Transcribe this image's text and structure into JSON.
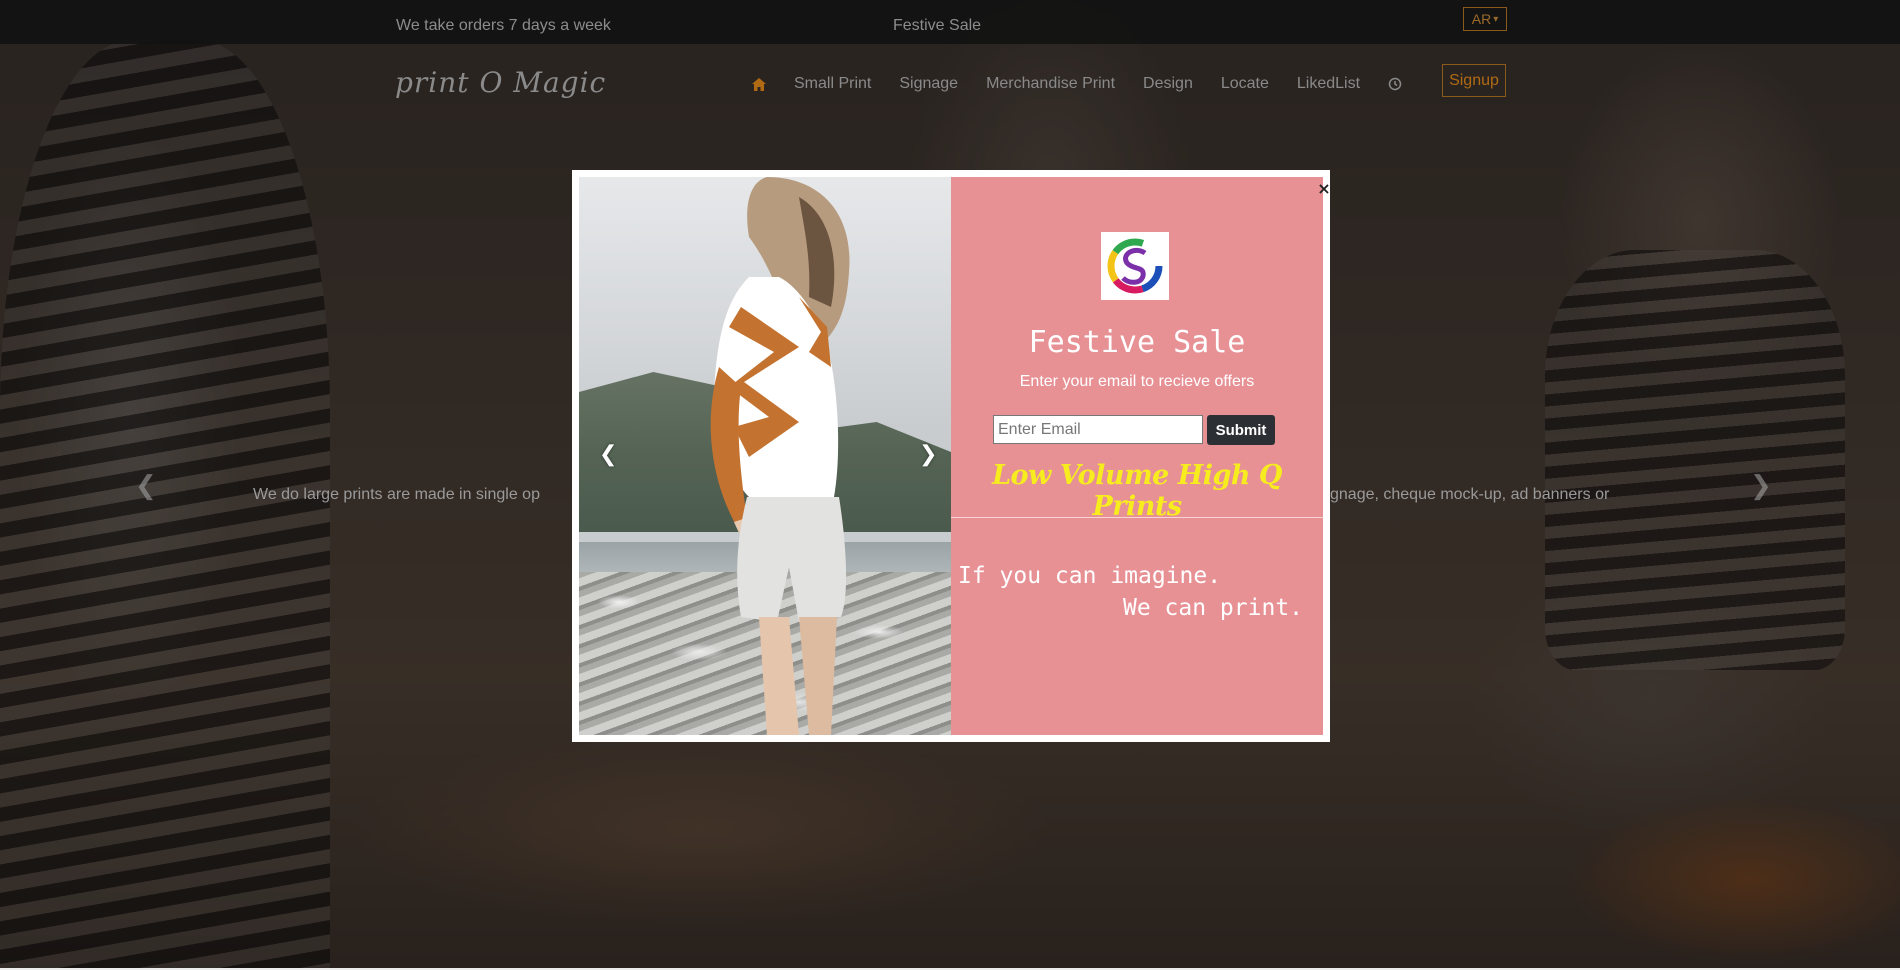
{
  "topbar": {
    "left_message": "We take orders 7 days a week",
    "center_message": "Festive Sale",
    "language": "AR"
  },
  "nav": {
    "brand": "print O Magic",
    "links": [
      "Small Print",
      "Signage",
      "Merchandise Print",
      "Design",
      "Locate",
      "LikedList"
    ],
    "signup_label": "Signup",
    "accent_color": "#b06a14"
  },
  "hero": {
    "caption_left": "We do large prints are made in single op",
    "caption_right": "gnage, cheque mock-up, ad banners or"
  },
  "modal": {
    "title": "Festive Sale",
    "subtitle": "Enter your email to recieve offers",
    "email_placeholder": "Enter Email",
    "submit_label": "Submit",
    "slogan": "Low Volume High Q Prints",
    "tagline_line1": "If you can imagine.",
    "tagline_line2": "We can print.",
    "close_symbol": "×",
    "panel_color": "#e79195",
    "slogan_color": "#f7ec1e"
  },
  "icons": {
    "home": "home-icon",
    "history": "history-icon",
    "close": "close-icon",
    "prev": "chevron-left-icon",
    "next": "chevron-right-icon",
    "logo": "s-logo-icon"
  }
}
